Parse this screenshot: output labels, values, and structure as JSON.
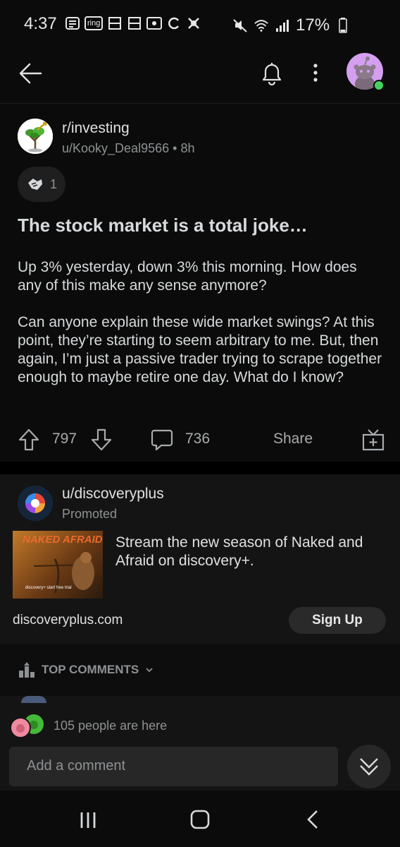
{
  "status_bar": {
    "time": "4:37",
    "ring_label": "ring",
    "battery": "17%",
    "icons": [
      "notes-icon",
      "ring-icon",
      "grid-icon",
      "grid-icon",
      "voicemail-icon",
      "sync-icon",
      "app-icon",
      "mute-icon",
      "wifi-icon",
      "signal-icon",
      "battery-icon"
    ]
  },
  "header": {
    "back_icon": "arrow-left-icon",
    "bell_icon": "bell-icon",
    "more_icon": "kebab-icon"
  },
  "post": {
    "subreddit": "r/investing",
    "author": "u/Kooky_Deal9566",
    "separator": "•",
    "age": "8h",
    "award_count": "1",
    "title": "The stock market is a total joke…",
    "body": [
      "Up 3% yesterday, down 3% this morning. How does any of this make any sense anymore?",
      "Can anyone explain these wide market swings? At this point, they’re starting to seem arbitrary to me. But, then again, I’m just a passive trader trying to scrape together enough to maybe retire one day. What do I know?"
    ],
    "upvotes": "797",
    "comments": "736",
    "share_label": "Share"
  },
  "ad": {
    "advertiser": "u/discoveryplus",
    "promoted_label": "Promoted",
    "image_text": "NAKED AFRAID",
    "image_sub": "discovery+ start free trial",
    "text": "Stream the new season of Naked and Afraid on discovery+.",
    "url": "discoveryplus.com",
    "cta": "Sign Up"
  },
  "comments_section": {
    "sort_label": "TOP COMMENTS"
  },
  "composer": {
    "presence_text": "105 people are here",
    "placeholder": "Add a comment"
  },
  "colors": {
    "background": "#0b0b0b",
    "text": "#d7dadc",
    "muted": "#8e9193",
    "online": "#46d160",
    "avatar_bg": "#d59ff0"
  }
}
